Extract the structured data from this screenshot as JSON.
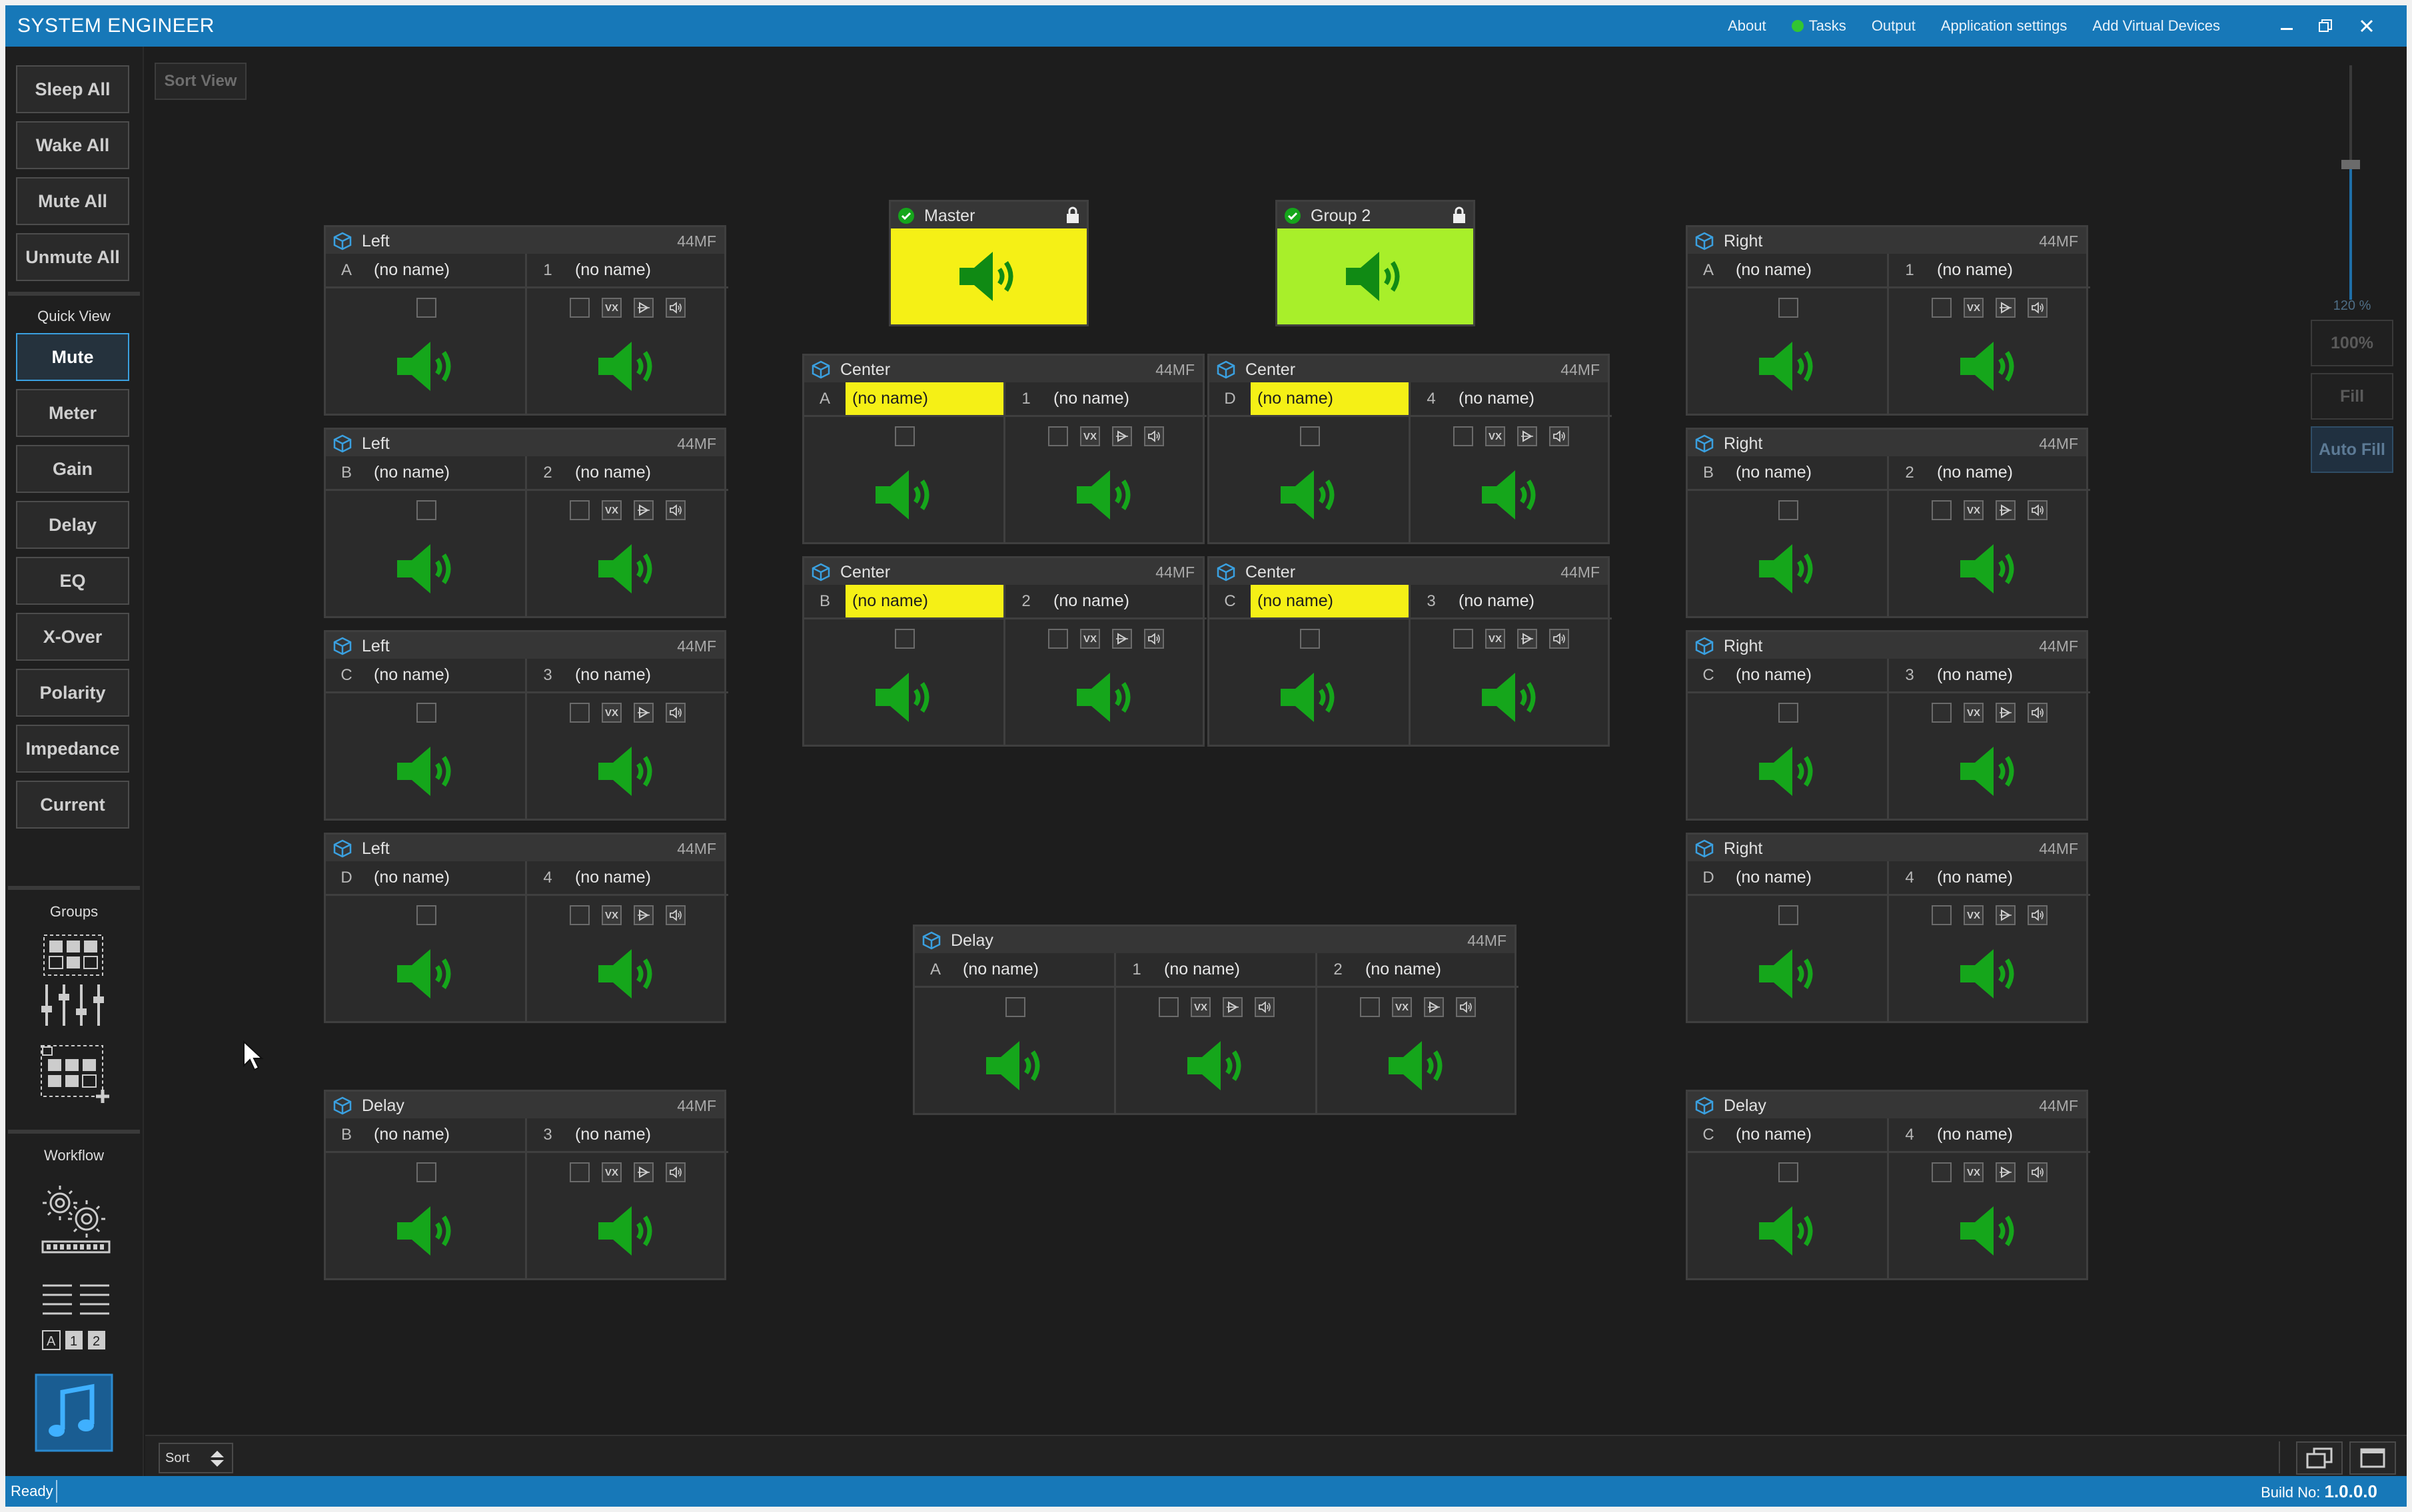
{
  "app": {
    "title": "SYSTEM ENGINEER",
    "menu": [
      "About",
      "Tasks",
      "Output",
      "Application settings",
      "Add Virtual Devices"
    ],
    "window_controls": [
      "minimize",
      "restore",
      "close"
    ]
  },
  "sidebar": {
    "actions": [
      "Sleep All",
      "Wake All",
      "Mute All",
      "Unmute All"
    ],
    "quick_view_label": "Quick View",
    "quick_view": [
      "Mute",
      "Meter",
      "Gain",
      "Delay",
      "EQ",
      "X-Over",
      "Polarity",
      "Impedance",
      "Current"
    ],
    "active_view": "Mute",
    "groups_label": "Groups",
    "workflow_label": "Workflow"
  },
  "toolbar": {
    "sort_view": "Sort View",
    "sort": "Sort"
  },
  "zoom": {
    "percent": "120 %",
    "level": 1.2,
    "buttons": [
      "100%",
      "Fill",
      "Auto Fill"
    ]
  },
  "colors": {
    "accent": "#1778b8",
    "speaker_on": "#15a61b",
    "highlight": "#f5f016",
    "master": "#f5f016",
    "group2": "#a8ef2a"
  },
  "groups": [
    {
      "name": "Master",
      "locked": true
    },
    {
      "name": "Group 2",
      "locked": true
    }
  ],
  "devices": [
    {
      "name": "Left",
      "model": "44MF",
      "channels": [
        {
          "id": "A",
          "name": "(no name)"
        },
        {
          "id": "1",
          "name": "(no name)"
        }
      ]
    },
    {
      "name": "Left",
      "model": "44MF",
      "channels": [
        {
          "id": "B",
          "name": "(no name)"
        },
        {
          "id": "2",
          "name": "(no name)"
        }
      ]
    },
    {
      "name": "Left",
      "model": "44MF",
      "channels": [
        {
          "id": "C",
          "name": "(no name)"
        },
        {
          "id": "3",
          "name": "(no name)"
        }
      ]
    },
    {
      "name": "Left",
      "model": "44MF",
      "channels": [
        {
          "id": "D",
          "name": "(no name)"
        },
        {
          "id": "4",
          "name": "(no name)"
        }
      ]
    },
    {
      "name": "Delay",
      "model": "44MF",
      "channels": [
        {
          "id": "B",
          "name": "(no name)"
        },
        {
          "id": "3",
          "name": "(no name)"
        }
      ]
    },
    {
      "name": "Center",
      "model": "44MF",
      "channels": [
        {
          "id": "A",
          "name": "(no name)",
          "hl": true
        },
        {
          "id": "1",
          "name": "(no name)"
        }
      ]
    },
    {
      "name": "Center",
      "model": "44MF",
      "channels": [
        {
          "id": "D",
          "name": "(no name)",
          "hl": true
        },
        {
          "id": "4",
          "name": "(no name)"
        }
      ]
    },
    {
      "name": "Center",
      "model": "44MF",
      "channels": [
        {
          "id": "B",
          "name": "(no name)",
          "hl": true
        },
        {
          "id": "2",
          "name": "(no name)"
        }
      ]
    },
    {
      "name": "Center",
      "model": "44MF",
      "channels": [
        {
          "id": "C",
          "name": "(no name)",
          "hl": true
        },
        {
          "id": "3",
          "name": "(no name)"
        }
      ]
    },
    {
      "name": "Delay",
      "model": "44MF",
      "channels": [
        {
          "id": "A",
          "name": "(no name)"
        },
        {
          "id": "1",
          "name": "(no name)"
        },
        {
          "id": "2",
          "name": "(no name)"
        }
      ]
    },
    {
      "name": "Right",
      "model": "44MF",
      "channels": [
        {
          "id": "A",
          "name": "(no name)"
        },
        {
          "id": "1",
          "name": "(no name)"
        }
      ]
    },
    {
      "name": "Right",
      "model": "44MF",
      "channels": [
        {
          "id": "B",
          "name": "(no name)"
        },
        {
          "id": "2",
          "name": "(no name)"
        }
      ]
    },
    {
      "name": "Right",
      "model": "44MF",
      "channels": [
        {
          "id": "C",
          "name": "(no name)"
        },
        {
          "id": "3",
          "name": "(no name)"
        }
      ]
    },
    {
      "name": "Right",
      "model": "44MF",
      "channels": [
        {
          "id": "D",
          "name": "(no name)"
        },
        {
          "id": "4",
          "name": "(no name)"
        }
      ]
    },
    {
      "name": "Delay",
      "model": "44MF",
      "channels": [
        {
          "id": "C",
          "name": "(no name)"
        },
        {
          "id": "4",
          "name": "(no name)"
        }
      ]
    }
  ],
  "tools": [
    "VX",
    "limiter",
    "speaker"
  ],
  "status": {
    "text": "Ready",
    "build_label": "Build No:",
    "build": "1.0.0.0"
  }
}
